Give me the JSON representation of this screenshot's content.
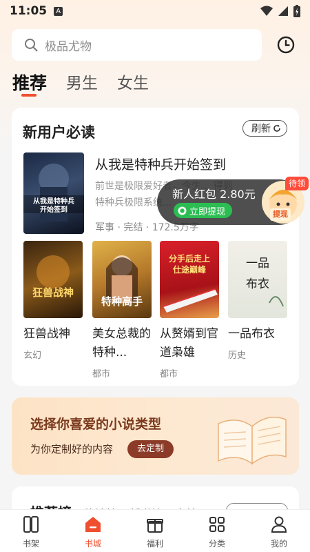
{
  "status_bar": {
    "time": "11:05",
    "indicator": "A"
  },
  "search": {
    "placeholder": "极品尤物"
  },
  "tabs": [
    {
      "label": "推荐",
      "active": true
    },
    {
      "label": "男生",
      "active": false
    },
    {
      "label": "女生",
      "active": false
    }
  ],
  "new_user_section": {
    "title": "新用户必读",
    "refresh_label": "刷新",
    "featured": {
      "title": "从我是特种兵开始签到",
      "description": "前世是极限爱好者，今生... 得到特种兵极限系统...",
      "meta": "军事 · 完结 · 172.5万字",
      "cover_text": "从我是特种兵开始签到"
    },
    "books": [
      {
        "title": "狂兽战神",
        "tag": "玄幻",
        "cover_text": "狂兽战神"
      },
      {
        "title": "美女总裁的特种...",
        "tag": "都市",
        "cover_text": "特种高手"
      },
      {
        "title": "从赘婿到官道枭雄",
        "tag": "都市",
        "cover_text": "分手后走上仕途巅峰"
      },
      {
        "title": "一品布衣",
        "tag": "历史",
        "cover_text": "一品布衣"
      }
    ]
  },
  "red_packet": {
    "text": "新人红包 2.80元",
    "button_label": "立即提现",
    "badge": "待领",
    "withdraw_label": "提现"
  },
  "banner": {
    "title": "选择你喜爱的小说类型",
    "subtitle": "为你定制好的内容",
    "button_label": "去定制"
  },
  "ranking_section": {
    "tabs": [
      "推荐榜",
      "热读榜",
      "新书榜",
      "完结"
    ]
  },
  "bottom_nav": [
    {
      "label": "书架",
      "icon": "bookshelf-icon",
      "active": false
    },
    {
      "label": "书城",
      "icon": "bookstore-icon",
      "active": true
    },
    {
      "label": "福利",
      "icon": "gift-icon",
      "active": false
    },
    {
      "label": "分类",
      "icon": "category-icon",
      "active": false
    },
    {
      "label": "我的",
      "icon": "profile-icon",
      "active": false
    }
  ],
  "colors": {
    "accent": "#f04f2f",
    "banner_button": "#8b3b27",
    "green": "#2bbd52"
  }
}
